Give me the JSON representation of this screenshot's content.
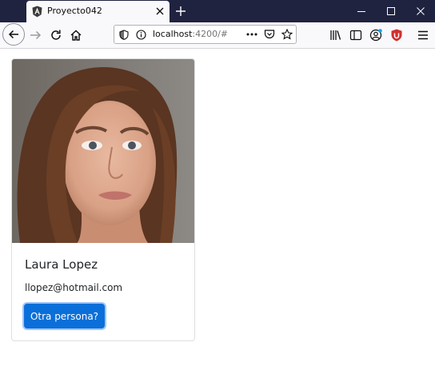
{
  "browser": {
    "tab": {
      "title": "Proyecto042",
      "favicon": "angular-icon"
    },
    "url": {
      "host": "localhost",
      "rest": ":4200/#"
    },
    "colors": {
      "titlebar": "#202340",
      "toolbar": "#f9f9fb"
    }
  },
  "card": {
    "title": "Laura Lopez",
    "text": "llopez@hotmail.com",
    "button_label": "Otra persona?",
    "photo": "portrait-photo",
    "button_color": "#0b6fd9"
  }
}
